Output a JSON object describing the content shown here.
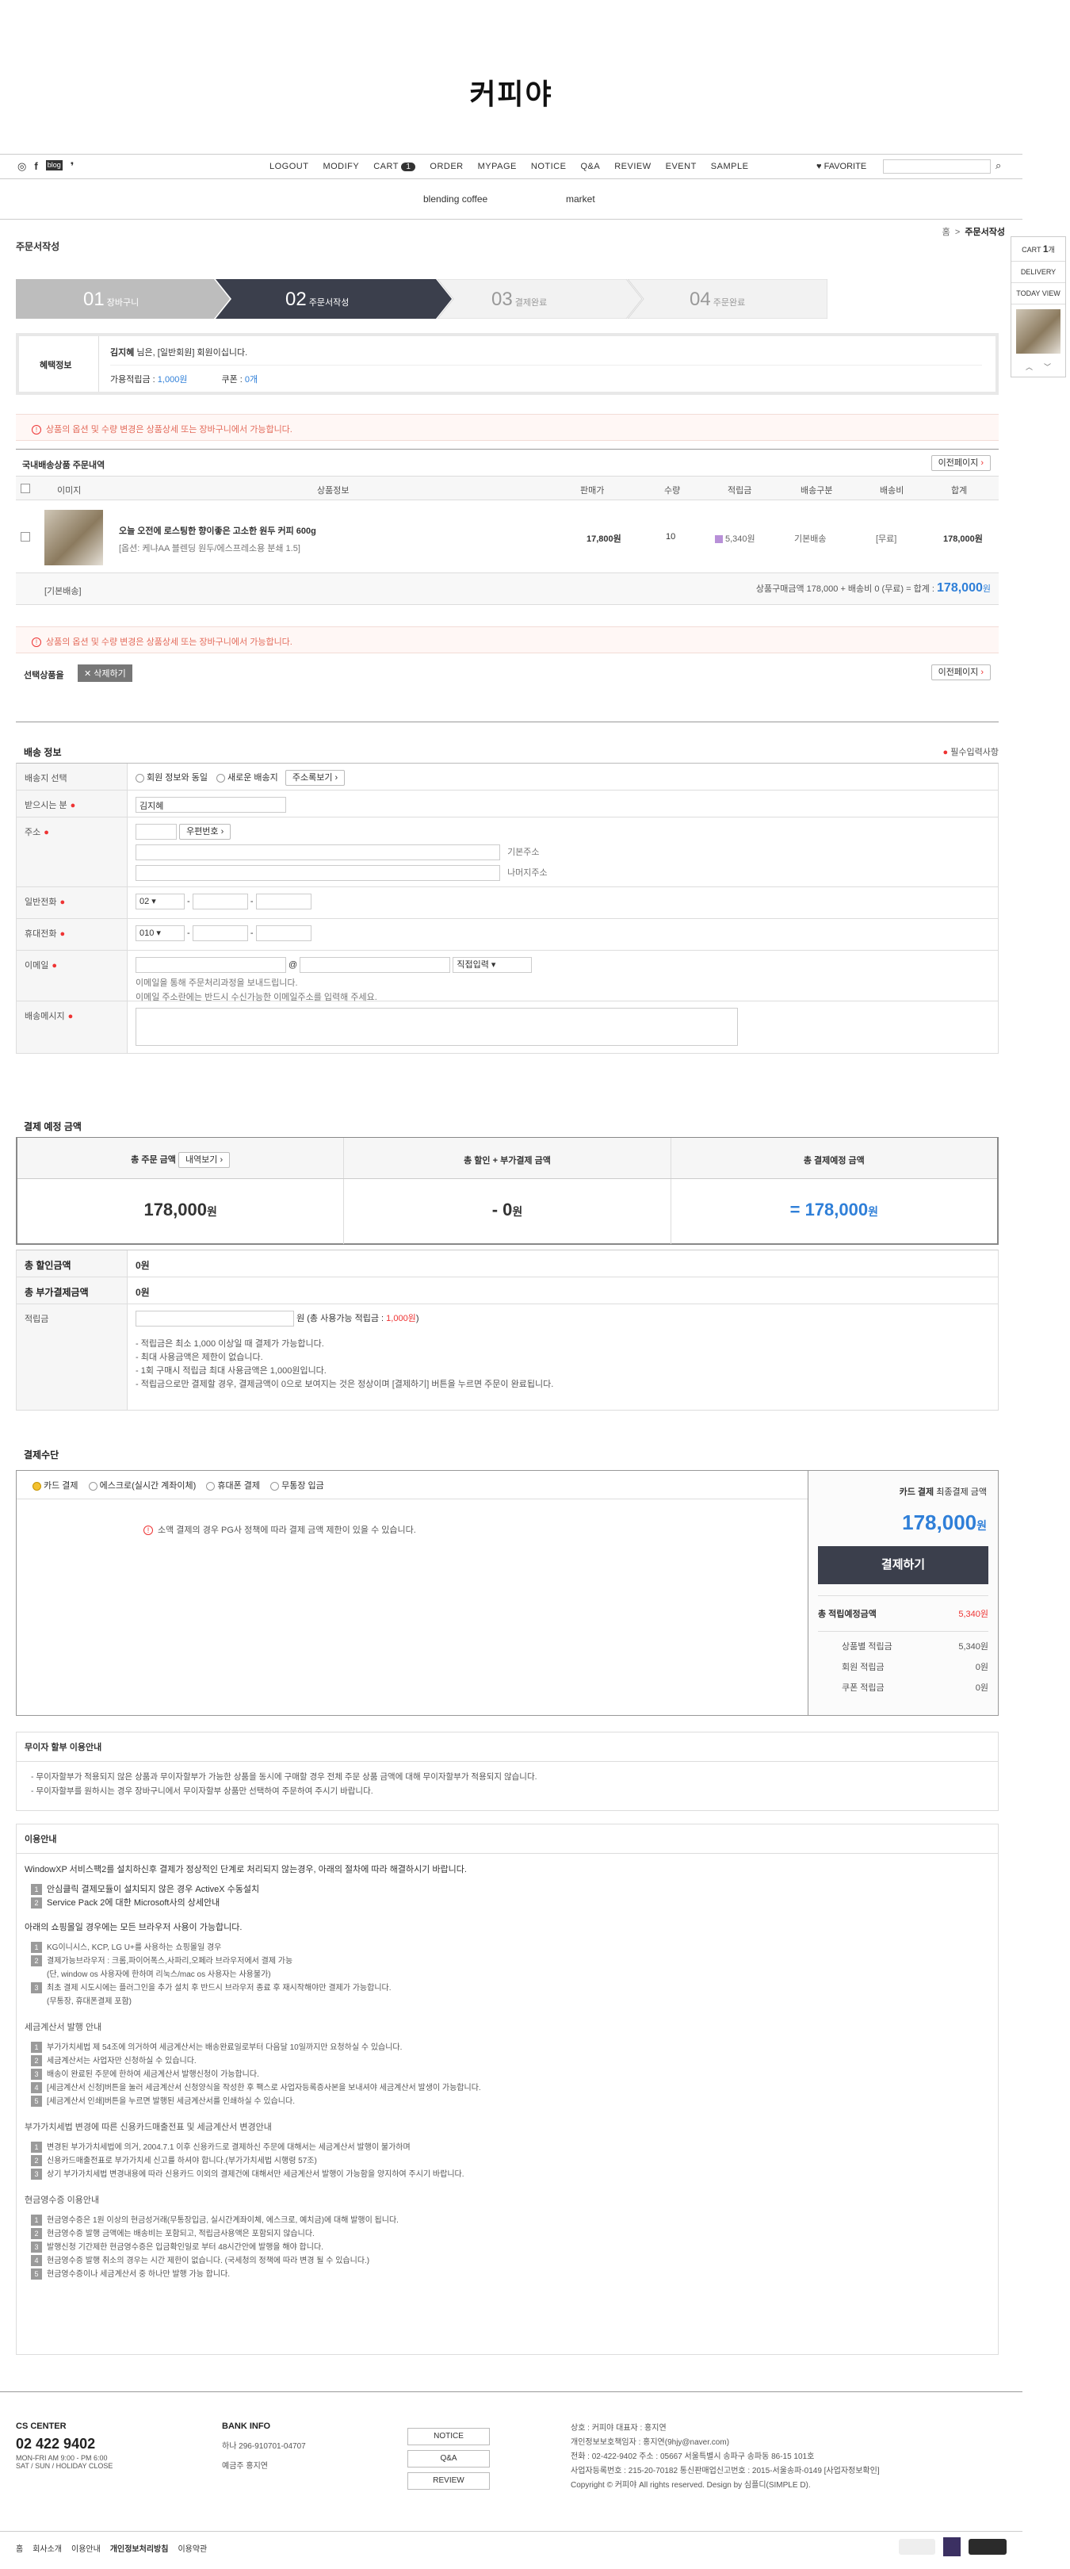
{
  "site": {
    "logo": "커피야"
  },
  "topnav": {
    "left_icons": [
      "instagram-icon",
      "facebook-icon",
      "blog-icon",
      "kakao-icon"
    ],
    "links": [
      "LOGOUT",
      "MODIFY",
      "CART",
      "ORDER",
      "MYPAGE",
      "NOTICE",
      "Q&A",
      "REVIEW",
      "EVENT",
      "SAMPLE"
    ],
    "cart_count": "1",
    "favorite": "♥ FAVORITE"
  },
  "catnav": [
    "blending coffee",
    "market"
  ],
  "breadcrumb": {
    "home": "홈",
    "current": "주문서작성"
  },
  "page_title": "주문서작성",
  "steps": [
    {
      "num": "01",
      "label": "장바구니"
    },
    {
      "num": "02",
      "label": "주문서작성"
    },
    {
      "num": "03",
      "label": "결제완료"
    },
    {
      "num": "04",
      "label": "주문완료"
    }
  ],
  "benefit": {
    "label": "혜택정보",
    "user": "김지혜",
    "line1_rest": " 님은, [일반회원] 회원이십니다.",
    "mileage_label": "가용적립금 :",
    "mileage_value": "1,000원",
    "coupon_label": "쿠폰 :",
    "coupon_value": "0개"
  },
  "notice_option": "상품의 옵션 및 수량 변경은 상품상세 또는 장바구니에서 가능합니다.",
  "cart": {
    "title": "국내배송상품 주문내역",
    "prev_btn": "이전페이지",
    "headers": [
      "이미지",
      "상품정보",
      "판매가",
      "수량",
      "적립금",
      "배송구분",
      "배송비",
      "합계"
    ],
    "item": {
      "name": "오늘 오전에 로스팅한 향이좋은 고소한 원두 커피 600g",
      "option": "[옵션: 케냐AA 블렌딩 원두/에스프레소용 분쇄 1.5]",
      "price": "17,800원",
      "qty": "10",
      "mileage": "5,340원",
      "ship_type": "기본배송",
      "ship_fee": "[무료]",
      "total": "178,000원"
    },
    "footer_left": "[기본배송]",
    "footer_sum": "상품구매금액 178,000 + 배송비 0 (무료) = 합계 :",
    "footer_total": "178,000",
    "footer_unit": "원"
  },
  "selected": {
    "label": "선택상품을",
    "delete_btn": "✕ 삭제하기",
    "prev_btn": "이전페이지"
  },
  "shipping": {
    "title": "배송 정보",
    "required_note": "필수입력사항",
    "dest_label": "배송지 선택",
    "dest_opt1": "회원 정보와 동일",
    "dest_opt2": "새로운 배송지",
    "dest_btn": "주소록보기",
    "recipient_label": "받으시는 분",
    "recipient_value": "김지혜",
    "addr_label": "주소",
    "zip_btn": "우편번호",
    "addr1_note": "기본주소",
    "addr2_note": "나머지주소",
    "phone_label": "일반전화",
    "phone_prefix": "02",
    "mobile_label": "휴대전화",
    "mobile_prefix": "010",
    "email_label": "이메일",
    "email_select": "직접입력",
    "email_note1": "이메일을 통해 주문처리과정을 보내드립니다.",
    "email_note2": "이메일 주소란에는 반드시 수신가능한 이메일주소를 입력해 주세요.",
    "msg_label": "배송메시지"
  },
  "payment_summary": {
    "title": "결제 예정 금액",
    "col1": "총 주문 금액",
    "col1_btn": "내역보기",
    "col2": "총 할인 + 부가결제 금액",
    "col3": "총 결제예정 금액",
    "v1": "178,000",
    "v2": "- 0",
    "v3": "= 178,000",
    "unit": "원",
    "discount_label": "총 할인금액",
    "discount_value": "0원",
    "extra_label": "총 부가결제금액",
    "extra_value": "0원",
    "points_label": "적립금",
    "points_text": "원 (총 사용가능 적립금 : ",
    "points_avail": "1,000원",
    "points_close": ")",
    "rules": [
      "- 적립금은 최소 1,000 이상일 때 결제가 가능합니다.",
      "- 최대 사용금액은 제한이 없습니다.",
      "- 1회 구매시 적립금 최대 사용금액은 1,000원입니다.",
      "- 적립금으로만 결제할 경우, 결제금액이 0으로 보여지는 것은 정상이며 [결제하기] 버튼을 누르면 주문이 완료됩니다."
    ]
  },
  "pay_method": {
    "title": "결제수단",
    "options": [
      "카드 결제",
      "에스크로(실시간 계좌이체)",
      "휴대폰 결제",
      "무통장 입금"
    ],
    "notice": "소액 결제의 경우 PG사 정책에 따라 결제 금액 제한이 있을 수 있습니다.",
    "side_title": "카드 결제",
    "side_sub": "최종결제 금액",
    "side_amount": "178,000",
    "side_unit": "원",
    "pay_btn": "결제하기",
    "expected_label": "총 적립예정금액",
    "expected_value": "5,340원",
    "rows": [
      {
        "label": "상품별 적립금",
        "value": "5,340원"
      },
      {
        "label": "회원 적립금",
        "value": "0원"
      },
      {
        "label": "쿠폰 적립금",
        "value": "0원"
      }
    ]
  },
  "nointerest": {
    "title": "무이자 할부 이용안내",
    "lines": [
      "- 무이자할부가 적용되지 않은 상품과 무이자할부가 가능한 상품을 동시에 구매할 경우 전체 주문 상품 금액에 대해 무이자할부가 적용되지 않습니다.",
      "- 무이자할부를 원하시는 경우 장바구니에서 무이자할부 상품만 선택하여 주문하여 주시기 바랍니다."
    ]
  },
  "guide": {
    "title": "이용안내",
    "intro": "WindowXP 서비스팩2를 설치하신후 결제가 정상적인 단계로 처리되지 않는경우, 아래의 절차에 따라 해결하시기 바랍니다.",
    "list1": [
      "안심클릭 결제모듈이 설치되지 않은 경우 ActiveX 수동설치",
      "Service Pack 2에 대한 Microsoft사의 상세안내"
    ],
    "sub2": "아래의 쇼핑몰일 경우에는 모든 브라우저 사용이 가능합니다.",
    "list2": [
      "KG이니시스, KCP, LG U+를 사용하는 쇼핑몰일 경우",
      "결제가능브라우저 : 크롬,파이어폭스,사파리,오페라 브라우저에서 결제 가능",
      "(단, window os 사용자에 한하며 리눅스/mac os 사용자는 사용불가)",
      "최초 결제 시도시에는 플러그인을 추가 설치 후 반드시 브라우저 종료 후 재시작해야만 결제가 가능합니다.",
      "(무통장, 휴대폰결제 포함)"
    ],
    "sub3": "세금계산서 발행 안내",
    "list3": [
      "부가가치세법 제 54조에 의거하여 세금계산서는 배송완료일로부터 다음달 10일까지만 요청하실 수 있습니다.",
      "세금계산서는 사업자만 신청하실 수 있습니다.",
      "배송이 완료된 주문에 한하여 세금계산서 발행신청이 가능합니다.",
      "[세금계산서 신청]버튼을 눌러 세금계산서 신청양식을 작성한 후 팩스로 사업자등록증사본을 보내셔야 세금계산서 발생이 가능합니다.",
      "[세금계산서 인쇄]버튼을 누르면 발행된 세금계산서를 인쇄하실 수 있습니다."
    ],
    "sub4": "부가가치세법 변경에 따른 신용카드매출전표 및 세금계산서 변경안내",
    "list4": [
      "변경된 부가가치세법에 의거, 2004.7.1 이후 신용카드로 결제하신 주문에 대해서는 세금계산서 발행이 불가하며",
      "신용카드매출전표로 부가가치세 신고를 하셔야 합니다.(부가가치세법 시행령 57조)",
      "상기 부가가치세법 변경내용에 따라 신용카드 이외의 결제건에 대해서만 세금계산서 발행이 가능함을 양지하여 주시기 바랍니다."
    ],
    "sub5": "현금영수증 이용안내",
    "list5": [
      "현금영수증은 1원 이상의 현금성거래(무통장입금, 실시간계좌이체, 에스크로, 예치금)에 대해 발행이 됩니다.",
      "현금영수증 발행 금액에는 배송비는 포함되고, 적립금사용액은 포함되지 않습니다.",
      "발행신청 기간제한 현금영수증은 입금확인일로 부터 48시간안에 발행을 해야 합니다.",
      "현금영수증 발행 취소의 경우는 시간 제한이 없습니다. (국세청의 정책에 따라 변경 될 수 있습니다.)",
      "현금영수증이나 세금계산서 중 하나만 발행 가능 합니다."
    ]
  },
  "footer": {
    "cs_title": "CS CENTER",
    "cs_phone": "02 422 9402",
    "cs_hours1": "MON-FRI AM 9:00 - PM 6:00",
    "cs_hours2": "SAT / SUN / HOLIDAY CLOSE",
    "bank_title": "BANK INFO",
    "bank_line": "하나 296-910701-04707",
    "bank_owner": "예금주 홍지연",
    "mid_btns": [
      "NOTICE",
      "Q&A",
      "REVIEW"
    ],
    "info1": "상호 : 커피야  대표자 : 홍지연",
    "info2": "개인정보보호책임자 : 홍지연(9hjy@naver.com)",
    "info3": "전화 : 02-422-9402  주소 : 05667 서울특별시 송파구 송파동 86-15 101호",
    "info4": "사업자등록번호 : 215-20-70182  통신판매업신고번호 : 2015-서울송파-0149  [사업자정보확인]",
    "info5": "Copyright © 커피야 All rights reserved. Design by 심플디(SIMPLE D).",
    "bottom_links": [
      "홈",
      "회사소개",
      "이용안내",
      "개인정보처리방침",
      "이용약관"
    ]
  },
  "quick": {
    "cart": "CART",
    "cart_count": "1",
    "cart_unit": "개",
    "delivery": "DELIVERY",
    "today": "TODAY VIEW"
  }
}
